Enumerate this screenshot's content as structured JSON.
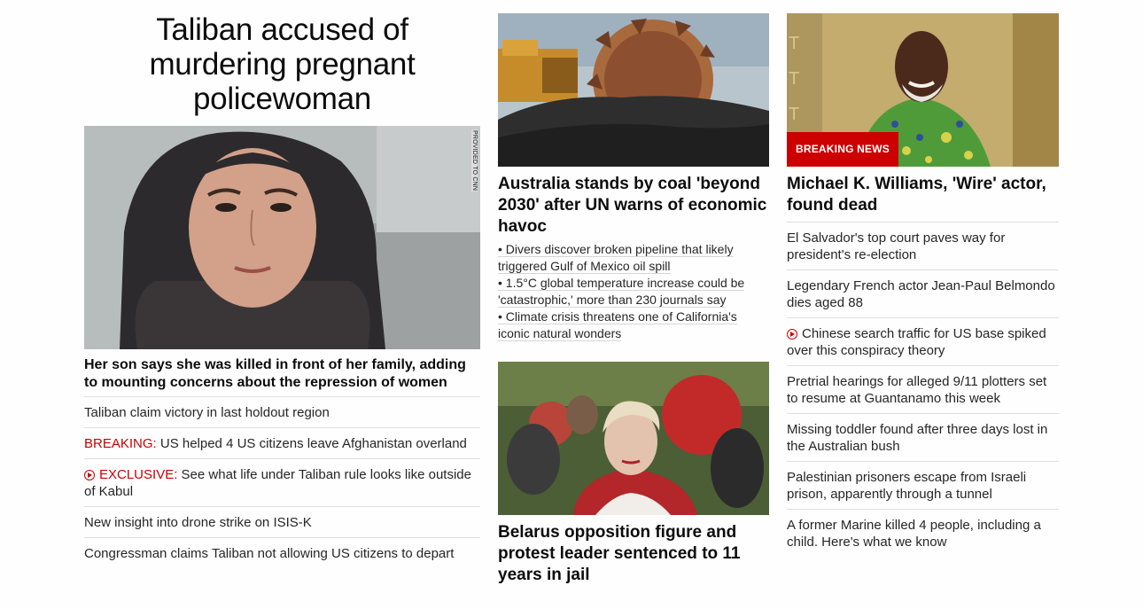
{
  "col1": {
    "headline": "Taliban accused of murdering pregnant policewoman",
    "image_tag": "PROVIDED TO CNN",
    "lead_sub": "Her son says she was killed in front of her family, adding to mounting concerns about the repression of women",
    "items": [
      {
        "label": "",
        "text": "Taliban claim victory in last holdout region"
      },
      {
        "label": "BREAKING:",
        "text": " US helped 4 US citizens leave Afghanistan overland"
      },
      {
        "label": "EXCLUSIVE:",
        "text": " See what life under Taliban rule looks like outside of Kabul",
        "icon": "play-icon"
      },
      {
        "label": "",
        "text": "New insight into drone strike on ISIS-K"
      },
      {
        "label": "",
        "text": "Congressman claims Taliban not allowing US citizens to depart"
      }
    ]
  },
  "col2": {
    "headline1": "Australia stands by coal 'beyond 2030' after UN warns of economic havoc",
    "bullets": [
      "• Divers discover broken pipeline that likely triggered Gulf of Mexico oil spill",
      "• 1.5°C global temperature increase could be 'catastrophic,' more than 230 journals say",
      "• Climate crisis threatens one of California's iconic natural wonders"
    ],
    "headline2": "Belarus opposition figure and protest leader sentenced to 11 years in jail"
  },
  "col3": {
    "badge": "BREAKING NEWS",
    "headline": "Michael K. Williams, 'Wire' actor, found dead",
    "items": [
      {
        "text": "El Salvador's top court paves way for president's re-election"
      },
      {
        "text": "Legendary French actor Jean-Paul Belmondo dies aged 88"
      },
      {
        "text": "Chinese search traffic for US base spiked over this conspiracy theory",
        "icon": "play-icon"
      },
      {
        "text": "Pretrial hearings for alleged 9/11 plotters set to resume at Guantanamo this week"
      },
      {
        "text": "Missing toddler found after three days lost in the Australian bush"
      },
      {
        "text": "Palestinian prisoners escape from Israeli prison, apparently through a tunnel"
      },
      {
        "text": "A former Marine killed 4 people, including a child. Here's what we know"
      }
    ]
  },
  "colors": {
    "accent_red": "#cc0000",
    "headline_text": "#0c0c0c",
    "body_text": "#262626",
    "divider": "#dfdfdf"
  }
}
